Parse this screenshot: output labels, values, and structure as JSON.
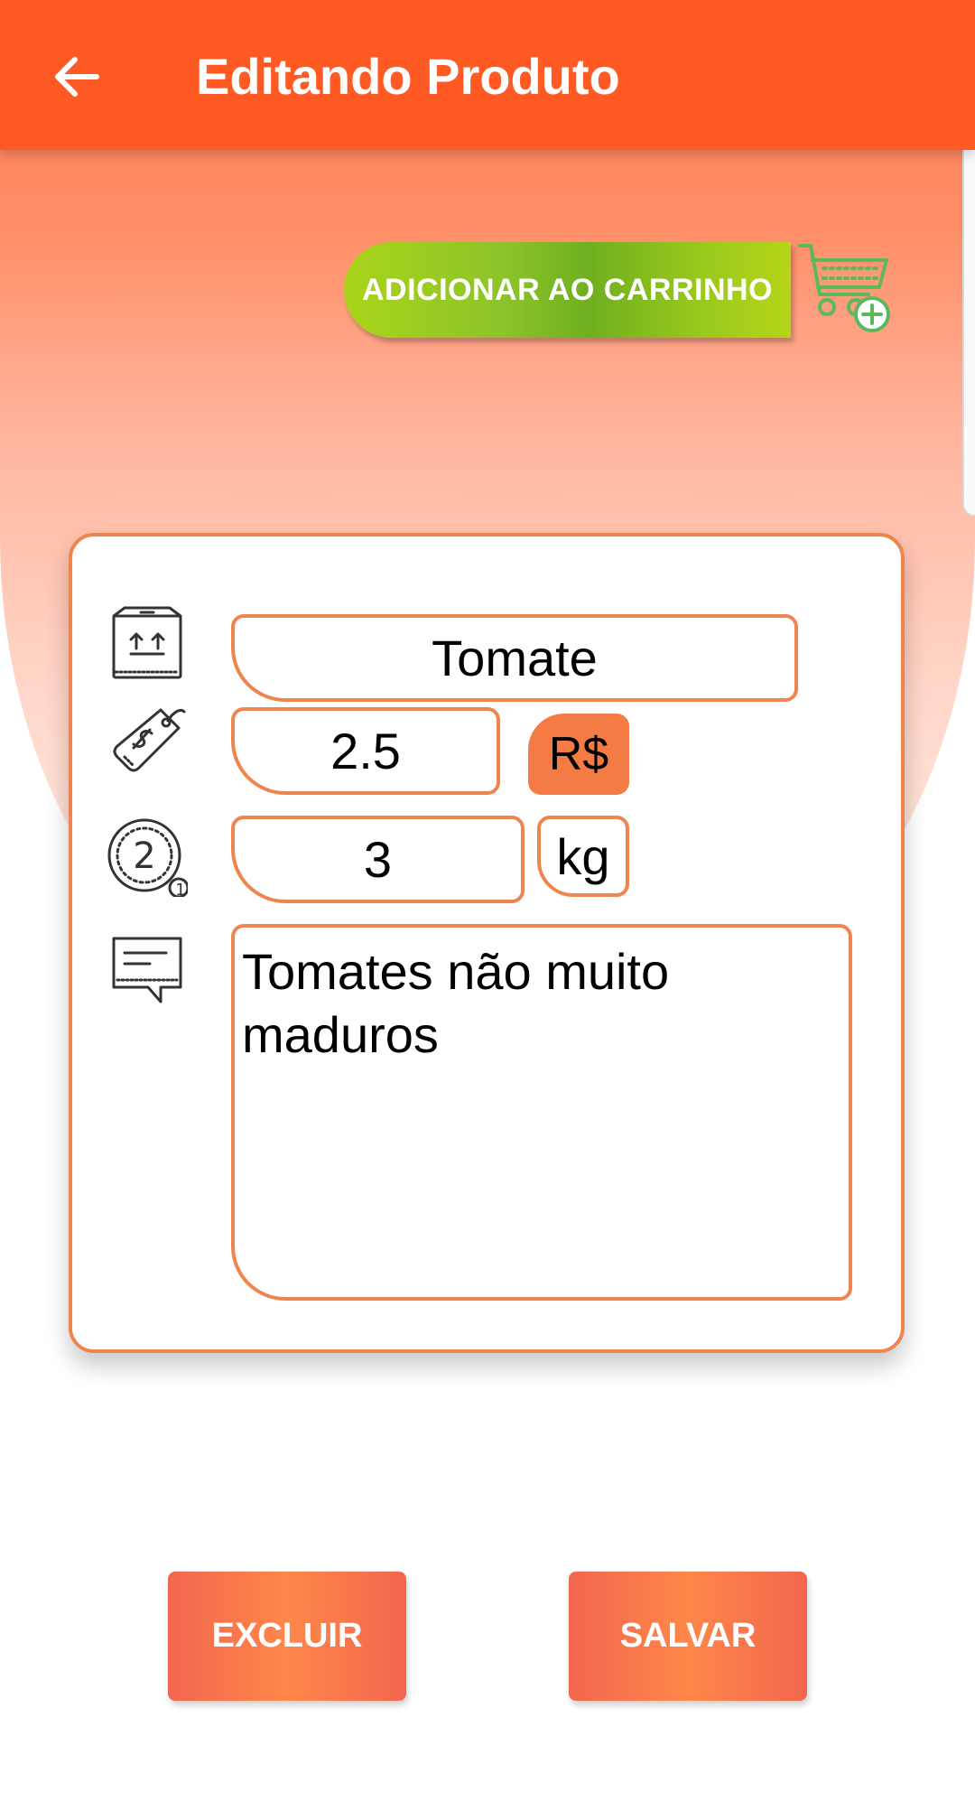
{
  "appbar": {
    "title": "Editando Produto",
    "back_icon": "arrow-left-icon",
    "color": "#ff5a24"
  },
  "cart_action": {
    "label": "ADICIONAR AO CARRINHO",
    "icon": "cart-plus-icon",
    "icon_color": "#5cb85c"
  },
  "product": {
    "name": "Tomate",
    "price": "2.5",
    "currency": "R$",
    "quantity": "3",
    "unit": "kg",
    "description": "Tomates não muito maduros"
  },
  "icons": {
    "name_row": "box-icon",
    "price_row": "price-tag-icon",
    "quantity_row": "coin-quantity-icon",
    "description_row": "comment-icon"
  },
  "actions": {
    "delete_label": "EXCLUIR",
    "save_label": "SALVAR"
  },
  "colors": {
    "accent": "#f0844e",
    "button": "#f47c44"
  }
}
